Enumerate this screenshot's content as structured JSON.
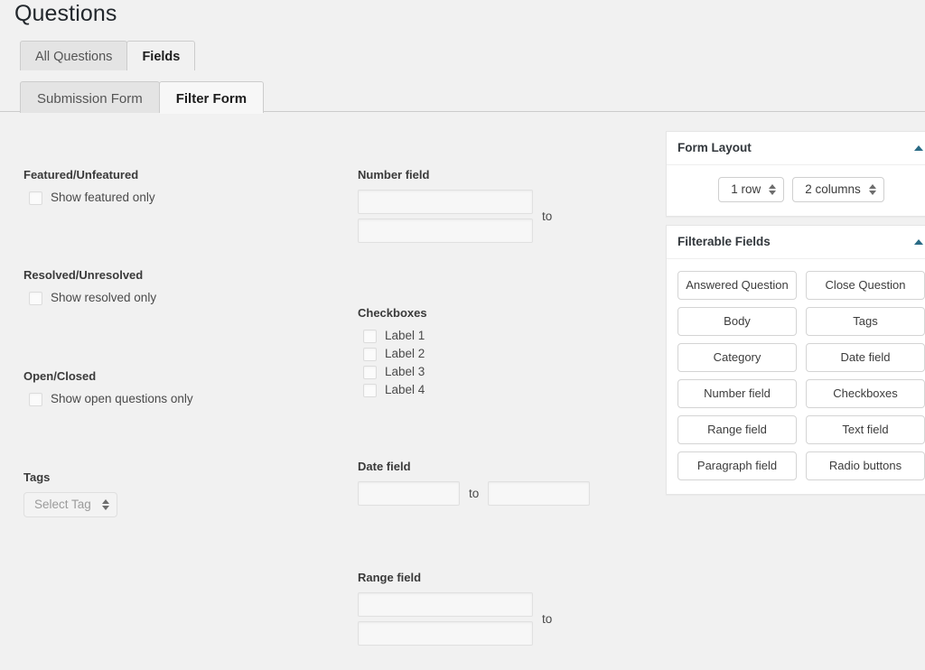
{
  "page": {
    "title": "Questions"
  },
  "tabs_primary": [
    {
      "label": "All Questions",
      "active": false
    },
    {
      "label": "Fields",
      "active": true
    }
  ],
  "tabs_secondary": [
    {
      "label": "Submission Form",
      "active": false
    },
    {
      "label": "Filter Form",
      "active": true
    }
  ],
  "left_column": {
    "featured": {
      "label": "Featured/Unfeatured",
      "checkbox_label": "Show featured only",
      "checked": false
    },
    "resolved": {
      "label": "Resolved/Unresolved",
      "checkbox_label": "Show resolved only",
      "checked": false
    },
    "open_closed": {
      "label": "Open/Closed",
      "checkbox_label": "Show open questions only",
      "checked": false
    },
    "tags": {
      "label": "Tags",
      "select_value": "Select Tag"
    }
  },
  "mid_column": {
    "number_field": {
      "label": "Number field",
      "from_value": "",
      "to_value": "",
      "separator": "to"
    },
    "checkboxes": {
      "label": "Checkboxes",
      "options": [
        {
          "label": "Label 1",
          "checked": false
        },
        {
          "label": "Label 2",
          "checked": false
        },
        {
          "label": "Label 3",
          "checked": false
        },
        {
          "label": "Label 4",
          "checked": false
        }
      ]
    },
    "date_field": {
      "label": "Date field",
      "from_value": "",
      "to_value": "",
      "separator": "to"
    },
    "range_field": {
      "label": "Range field",
      "from_value": "",
      "to_value": "",
      "separator": "to"
    }
  },
  "sidebar": {
    "form_layout": {
      "title": "Form Layout",
      "toggle_icon": "chevron-up-icon",
      "rows_value": "1 row",
      "columns_value": "2 columns"
    },
    "filterable_fields": {
      "title": "Filterable Fields",
      "toggle_icon": "chevron-up-icon",
      "items": [
        "Answered Question",
        "Close Question",
        "Body",
        "Tags",
        "Category",
        "Date field",
        "Number field",
        "Checkboxes",
        "Range field",
        "Text field",
        "Paragraph field",
        "Radio buttons"
      ]
    }
  },
  "colors": {
    "page_background": "#f1f1f1",
    "panel_background": "#ffffff",
    "toggle_accent": "#2a6b85",
    "tab_inactive": "#e4e4e4",
    "border": "#cccccc"
  }
}
